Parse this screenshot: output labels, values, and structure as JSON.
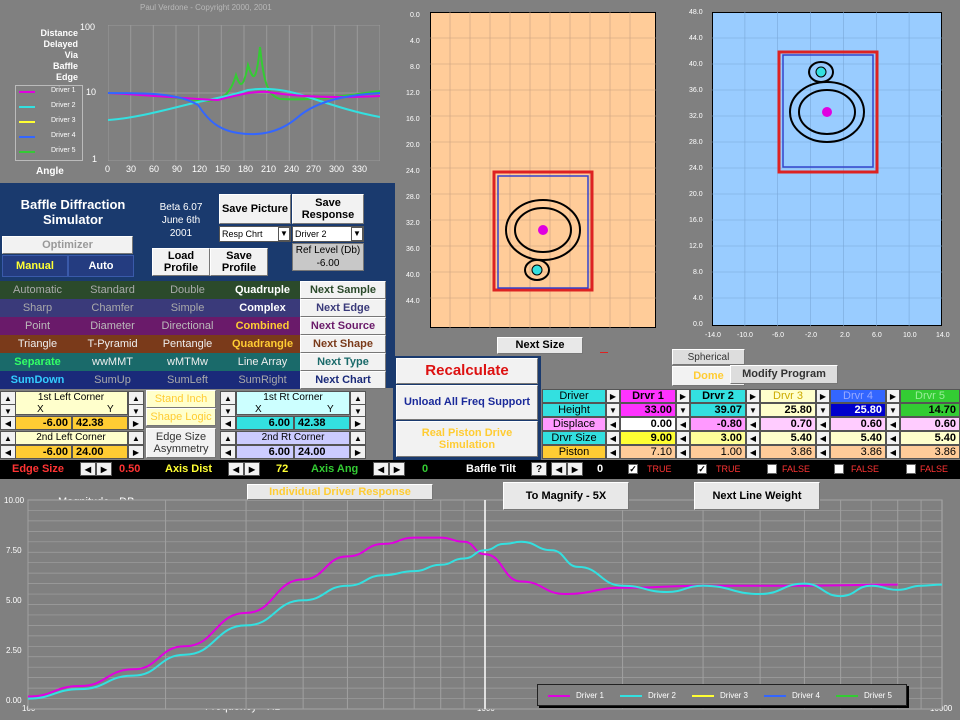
{
  "copyright": "Paul Verdone  -  Copyright  2000, 2001",
  "polar": {
    "side_label": [
      "Distance",
      "Delayed",
      "Via",
      "Baffle",
      "Edge"
    ],
    "y_ticks": [
      "100",
      "10",
      "1"
    ],
    "x_ticks": [
      "0",
      "30",
      "60",
      "90",
      "120",
      "150",
      "180",
      "210",
      "240",
      "270",
      "300",
      "330"
    ],
    "angle_label": "Angle",
    "legend": [
      "Driver 1",
      "Driver 2",
      "Driver 3",
      "Driver 4",
      "Driver 5"
    ]
  },
  "app": {
    "title_line1": "Baffle Diffraction",
    "title_line2": "Simulator",
    "version": "Beta 6.07",
    "date": "June 6th",
    "year": "2001"
  },
  "buttons": {
    "optimizer": "Optimizer",
    "manual": "Manual",
    "auto": "Auto",
    "save_picture": "Save Picture",
    "resp_chrt": "Resp Chrt",
    "save_response": "Save Response",
    "driver_sel": "Driver 2",
    "ref_level_label": "Ref Level (Db)",
    "ref_level_value": "-6.00",
    "load_profile": "Load Profile",
    "save_profile": "Save Profile",
    "recalculate": "Recalculate",
    "unload": "Unload All Freq Support",
    "real_piston": "Real Piston Drive Simulation",
    "next_size": "Next Size",
    "spherical": "Spherical",
    "dome": "Dome",
    "modify_program": "Modify Program",
    "individual": "Individual Driver Response",
    "magnify": "To Magnify - 5X",
    "next_line": "Next Line Weight"
  },
  "grid_rows": [
    {
      "items": [
        "Automatic",
        "Standard",
        "Double",
        "Quadruple"
      ],
      "next": "Next Sample"
    },
    {
      "items": [
        "Sharp",
        "Chamfer",
        "Simple",
        "Complex"
      ],
      "next": "Next Edge"
    },
    {
      "items": [
        "Point",
        "Diameter",
        "Directional",
        "Combined"
      ],
      "next": "Next Source"
    },
    {
      "items": [
        "Triangle",
        "T-Pyramid",
        "Pentangle",
        "Quadrangle"
      ],
      "next": "Next Shape"
    },
    {
      "items": [
        "Separate",
        "wwMMT",
        "wMTMw",
        "Line Array"
      ],
      "next": "Next Type"
    },
    {
      "items": [
        "SumDown",
        "SumUp",
        "SumLeft",
        "SumRight"
      ],
      "next": "Next Chart"
    }
  ],
  "corners": {
    "left1": "1st Left Corner",
    "left2": "2nd Left Corner",
    "x": "X",
    "y": "Y",
    "l1x": "-6.00",
    "l1y": "42.38",
    "l2x": "-6.00",
    "l2y": "24.00",
    "stand_inch": "Stand Inch",
    "shape_logic": "Shape Logic",
    "edge_asym": "Edge Size Asymmetry",
    "rt1": "1st Rt Corner",
    "rt2": "2nd Rt Corner",
    "r1x": "6.00",
    "r1y": "42.38",
    "r2x": "6.00",
    "r2y": "24.00"
  },
  "table": {
    "rows": [
      "Driver",
      "Height",
      "Displace",
      "Drvr Size",
      "Piston"
    ],
    "cols": [
      "Drvr 1",
      "Drvr 2",
      "Drvr 3",
      "Drvr 4",
      "Drvr 5"
    ],
    "height": [
      "33.00",
      "39.07",
      "25.80",
      "25.80",
      "14.70"
    ],
    "displace": [
      "0.00",
      "-0.80",
      "0.70",
      "0.60",
      "0.60"
    ],
    "size": [
      "9.00",
      "3.00",
      "5.40",
      "5.40",
      "5.40"
    ],
    "piston": [
      "7.10",
      "1.00",
      "3.86",
      "3.86",
      "3.86"
    ]
  },
  "status": {
    "edge_size": "Edge Size",
    "edge_val": "0.50",
    "axis_dist": "Axis Dist",
    "axis_val": "72",
    "axis_ang": "Axis Ang",
    "ang_val": "0",
    "baffle_tilt": "Baffle Tilt",
    "tilt_q": "?",
    "tilt_val": "0",
    "checks": [
      "TRUE",
      "TRUE",
      "FALSE",
      "FALSE",
      "FALSE"
    ]
  },
  "baffle_plot": {
    "y_ticks": [
      "0.0",
      "4.0",
      "8.0",
      "12.0",
      "16.0",
      "20.0",
      "24.0",
      "28.0",
      "32.0",
      "36.0",
      "40.0",
      "44.0"
    ]
  },
  "side_plot": {
    "y_ticks": [
      "48.0",
      "44.0",
      "40.0",
      "36.0",
      "32.0",
      "28.0",
      "24.0",
      "20.0",
      "16.0",
      "12.0",
      "8.0",
      "4.0",
      "0.0"
    ],
    "x_ticks": [
      "-14.0",
      "-10.0",
      "-6.0",
      "-2.0",
      "2.0",
      "6.0",
      "10.0",
      "14.0"
    ]
  },
  "chart_data": {
    "type": "line",
    "title": "Magnitude  -  DB",
    "xlabel": "Frequency  -  Hz",
    "x_scale": "log",
    "xlim": [
      100,
      10000
    ],
    "ylim": [
      0,
      10
    ],
    "y_ticks": [
      "10.00",
      "7.50",
      "5.00",
      "2.50",
      "0.00"
    ],
    "x_ticks": [
      "100",
      "1000",
      "10000"
    ],
    "legend": [
      "Driver 1",
      "Driver 2",
      "Driver 3",
      "Driver 4",
      "Driver 5"
    ],
    "series": [
      {
        "name": "Driver 1",
        "color": "#e000e0",
        "x": [
          100,
          130,
          170,
          220,
          300,
          400,
          500,
          600,
          700,
          800,
          900,
          1000,
          1200,
          1500,
          2000,
          3000,
          5000,
          8000
        ],
        "y": [
          0.6,
          1.1,
          1.9,
          3.0,
          4.6,
          6.2,
          7.3,
          7.9,
          8.2,
          8.2,
          8.0,
          7.4,
          6.1,
          5.5,
          5.8,
          5.9,
          5.9,
          5.95
        ]
      },
      {
        "name": "Driver 2",
        "color": "#33e0e0",
        "x": [
          100,
          130,
          170,
          220,
          300,
          400,
          500,
          600,
          700,
          800,
          900,
          1000,
          1100,
          1200,
          1400,
          1600,
          2000,
          2500,
          3000,
          4000,
          5000,
          6000,
          7000,
          8000,
          9000,
          10000
        ],
        "y": [
          0.5,
          0.95,
          1.6,
          2.6,
          4.0,
          5.2,
          5.9,
          6.4,
          6.6,
          6.9,
          7.2,
          7.6,
          7.9,
          8.0,
          7.6,
          6.8,
          5.9,
          5.6,
          5.9,
          5.5,
          6.0,
          5.4,
          5.9,
          5.7,
          5.9,
          5.95
        ]
      },
      {
        "name": "Driver 3",
        "color": "#ffff33",
        "x": [],
        "y": []
      },
      {
        "name": "Driver 4",
        "color": "#3366ff",
        "x": [],
        "y": []
      },
      {
        "name": "Driver 5",
        "color": "#33cc33",
        "x": [],
        "y": []
      }
    ]
  }
}
